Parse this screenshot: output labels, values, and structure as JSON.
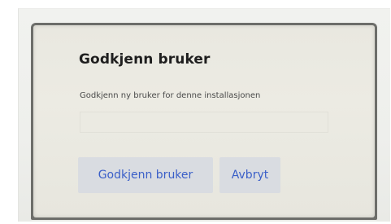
{
  "dialog": {
    "title": "Godkjenn bruker",
    "message": "Godkjenn ny bruker for denne installasjonen",
    "input": {
      "value": "",
      "placeholder": ""
    },
    "buttons": {
      "approve_label": "Godkjenn bruker",
      "cancel_label": "Avbryt"
    }
  },
  "colors": {
    "dialog_background": "#ecebe3",
    "button_background": "#d9dce1",
    "button_text": "#3a5fc8",
    "title_text": "#1f1f1f",
    "bezel": "#6d6e6a"
  }
}
